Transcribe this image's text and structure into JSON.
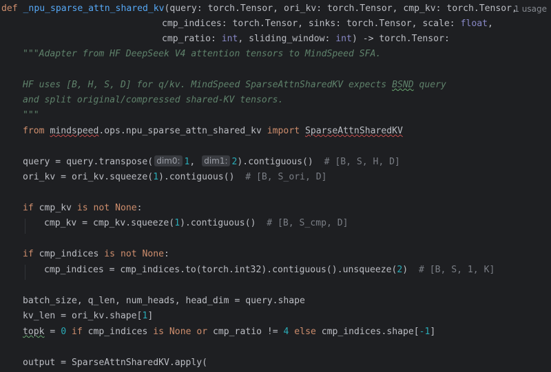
{
  "usage_label": "1 usage",
  "code": {
    "l1": {
      "def": "def",
      "fname": "_npu_sparse_attn_shared_kv",
      "sig": "(query: torch.Tensor, ori_kv: torch.Tensor, cmp_kv: torch.Tensor,"
    },
    "l2": {
      "a": "cmp_indices: torch.Tensor, sinks: torch.Tensor, scale: ",
      "type": "float",
      "b": ","
    },
    "l3": {
      "a": "cmp_ratio: ",
      "type1": "int",
      "b": ", sliding_window: ",
      "type2": "int",
      "c": ") -> torch.Tensor:"
    },
    "l4": {
      "text": "\"\"\"Adapter from HF DeepSeek V4 attention tensors to MindSpeed SFA."
    },
    "l6": {
      "a": "HF uses [B, H, S, D] for q/kv. MindSpeed SparseAttnSharedKV expects ",
      "bsnd": "BSND",
      "b": " query"
    },
    "l7": {
      "text": "and split original/compressed shared-KV tensors."
    },
    "l8": {
      "text": "\"\"\""
    },
    "l9": {
      "from": "from",
      "module": "mindspeed",
      "rest": ".ops.npu_sparse_attn_shared_kv ",
      "import": "import",
      "cls": "SparseAttnSharedKV"
    },
    "l11": {
      "a": "query = query.transpose(",
      "hint1": "dim0:",
      "v1": "1",
      "sep": ",",
      "hint2": "dim1:",
      "v2": "2",
      "b": ").contiguous()",
      "comment": "# [B, S, H, D]"
    },
    "l12": {
      "a": "ori_kv = ori_kv.squeeze(",
      "v": "1",
      "b": ").contiguous()",
      "comment": "# [B, S_ori, D]"
    },
    "l14": {
      "if": "if",
      "a": " cmp_kv ",
      "is": "is",
      "not": "not",
      "none": "None",
      "colon": ":"
    },
    "l15": {
      "a": "cmp_kv = cmp_kv.squeeze(",
      "v": "1",
      "b": ").contiguous()",
      "comment": "# [B, S_cmp, D]"
    },
    "l17": {
      "if": "if",
      "a": " cmp_indices ",
      "is": "is",
      "not": "not",
      "none": "None",
      "colon": ":"
    },
    "l18": {
      "a": "cmp_indices = cmp_indices.to(torch.int32).contiguous().unsqueeze(",
      "v": "2",
      "b": ")",
      "comment": "# [B, S, 1, K]"
    },
    "l20": {
      "text": "batch_size, q_len, num_heads, head_dim = query.shape"
    },
    "l21": {
      "a": "kv_len = ori_kv.shape[",
      "v": "1",
      "b": "]"
    },
    "l22": {
      "topk": "topk",
      "a": " = ",
      "v0": "0",
      "if": "if",
      "b": " cmp_indices ",
      "is": "is",
      "none": "None",
      "or": "or",
      "c": " cmp_ratio != ",
      "v4": "4",
      "else": "else",
      "d": " cmp_indices.shape[",
      "vm1": "-1",
      "e": "]"
    },
    "l24": {
      "text": "output = SparseAttnSharedKV.apply("
    }
  }
}
